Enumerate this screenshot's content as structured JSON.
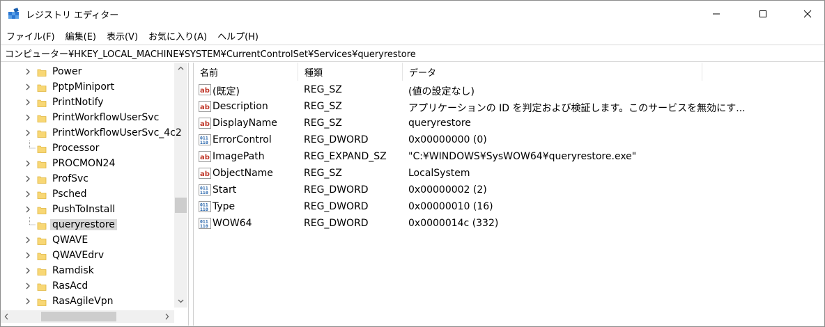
{
  "window": {
    "title": "レジストリ エディター",
    "icons": {
      "app": "registry-editor-icon",
      "minimize": "minimize-icon",
      "maximize": "maximize-icon",
      "close": "close-icon"
    }
  },
  "menu": [
    "ファイル(F)",
    "編集(E)",
    "表示(V)",
    "お気に入り(A)",
    "ヘルプ(H)"
  ],
  "address": "コンピューター¥HKEY_LOCAL_MACHINE¥SYSTEM¥CurrentControlSet¥Services¥queryrestore",
  "tree": {
    "items": [
      {
        "label": "Power",
        "expandable": true
      },
      {
        "label": "PptpMiniport",
        "expandable": true
      },
      {
        "label": "PrintNotify",
        "expandable": true
      },
      {
        "label": "PrintWorkflowUserSvc",
        "expandable": true
      },
      {
        "label": "PrintWorkflowUserSvc_4c2",
        "expandable": true
      },
      {
        "label": "Processor",
        "expandable": false
      },
      {
        "label": "PROCMON24",
        "expandable": true
      },
      {
        "label": "ProfSvc",
        "expandable": true
      },
      {
        "label": "Psched",
        "expandable": true
      },
      {
        "label": "PushToInstall",
        "expandable": true
      },
      {
        "label": "queryrestore",
        "expandable": false,
        "selected": true
      },
      {
        "label": "QWAVE",
        "expandable": true
      },
      {
        "label": "QWAVEdrv",
        "expandable": true
      },
      {
        "label": "Ramdisk",
        "expandable": true
      },
      {
        "label": "RasAcd",
        "expandable": true
      },
      {
        "label": "RasAgileVpn",
        "expandable": true
      }
    ]
  },
  "values_pane": {
    "headers": {
      "name": "名前",
      "type": "種類",
      "data": "データ"
    },
    "rows": [
      {
        "name": "(既定)",
        "type": "REG_SZ",
        "data": "(値の設定なし)",
        "icon": "string-value-icon"
      },
      {
        "name": "Description",
        "type": "REG_SZ",
        "data": "アプリケーションの ID を判定および検証します。このサービスを無効にす...",
        "icon": "string-value-icon"
      },
      {
        "name": "DisplayName",
        "type": "REG_SZ",
        "data": "queryrestore",
        "icon": "string-value-icon"
      },
      {
        "name": "ErrorControl",
        "type": "REG_DWORD",
        "data": "0x00000000 (0)",
        "icon": "binary-value-icon"
      },
      {
        "name": "ImagePath",
        "type": "REG_EXPAND_SZ",
        "data": "\"C:¥WINDOWS¥SysWOW64¥queryrestore.exe\"",
        "icon": "string-value-icon"
      },
      {
        "name": "ObjectName",
        "type": "REG_SZ",
        "data": "LocalSystem",
        "icon": "string-value-icon"
      },
      {
        "name": "Start",
        "type": "REG_DWORD",
        "data": "0x00000002 (2)",
        "icon": "binary-value-icon"
      },
      {
        "name": "Type",
        "type": "REG_DWORD",
        "data": "0x00000010 (16)",
        "icon": "binary-value-icon"
      },
      {
        "name": "WOW64",
        "type": "REG_DWORD",
        "data": "0x0000014c (332)",
        "icon": "binary-value-icon"
      }
    ]
  },
  "colors": {
    "folder": "#f8d775",
    "folder_dark": "#e0b53c",
    "string_icon": "#c0392b",
    "binary_icon": "#1f5fa8",
    "selection": "#d9d9d9"
  }
}
